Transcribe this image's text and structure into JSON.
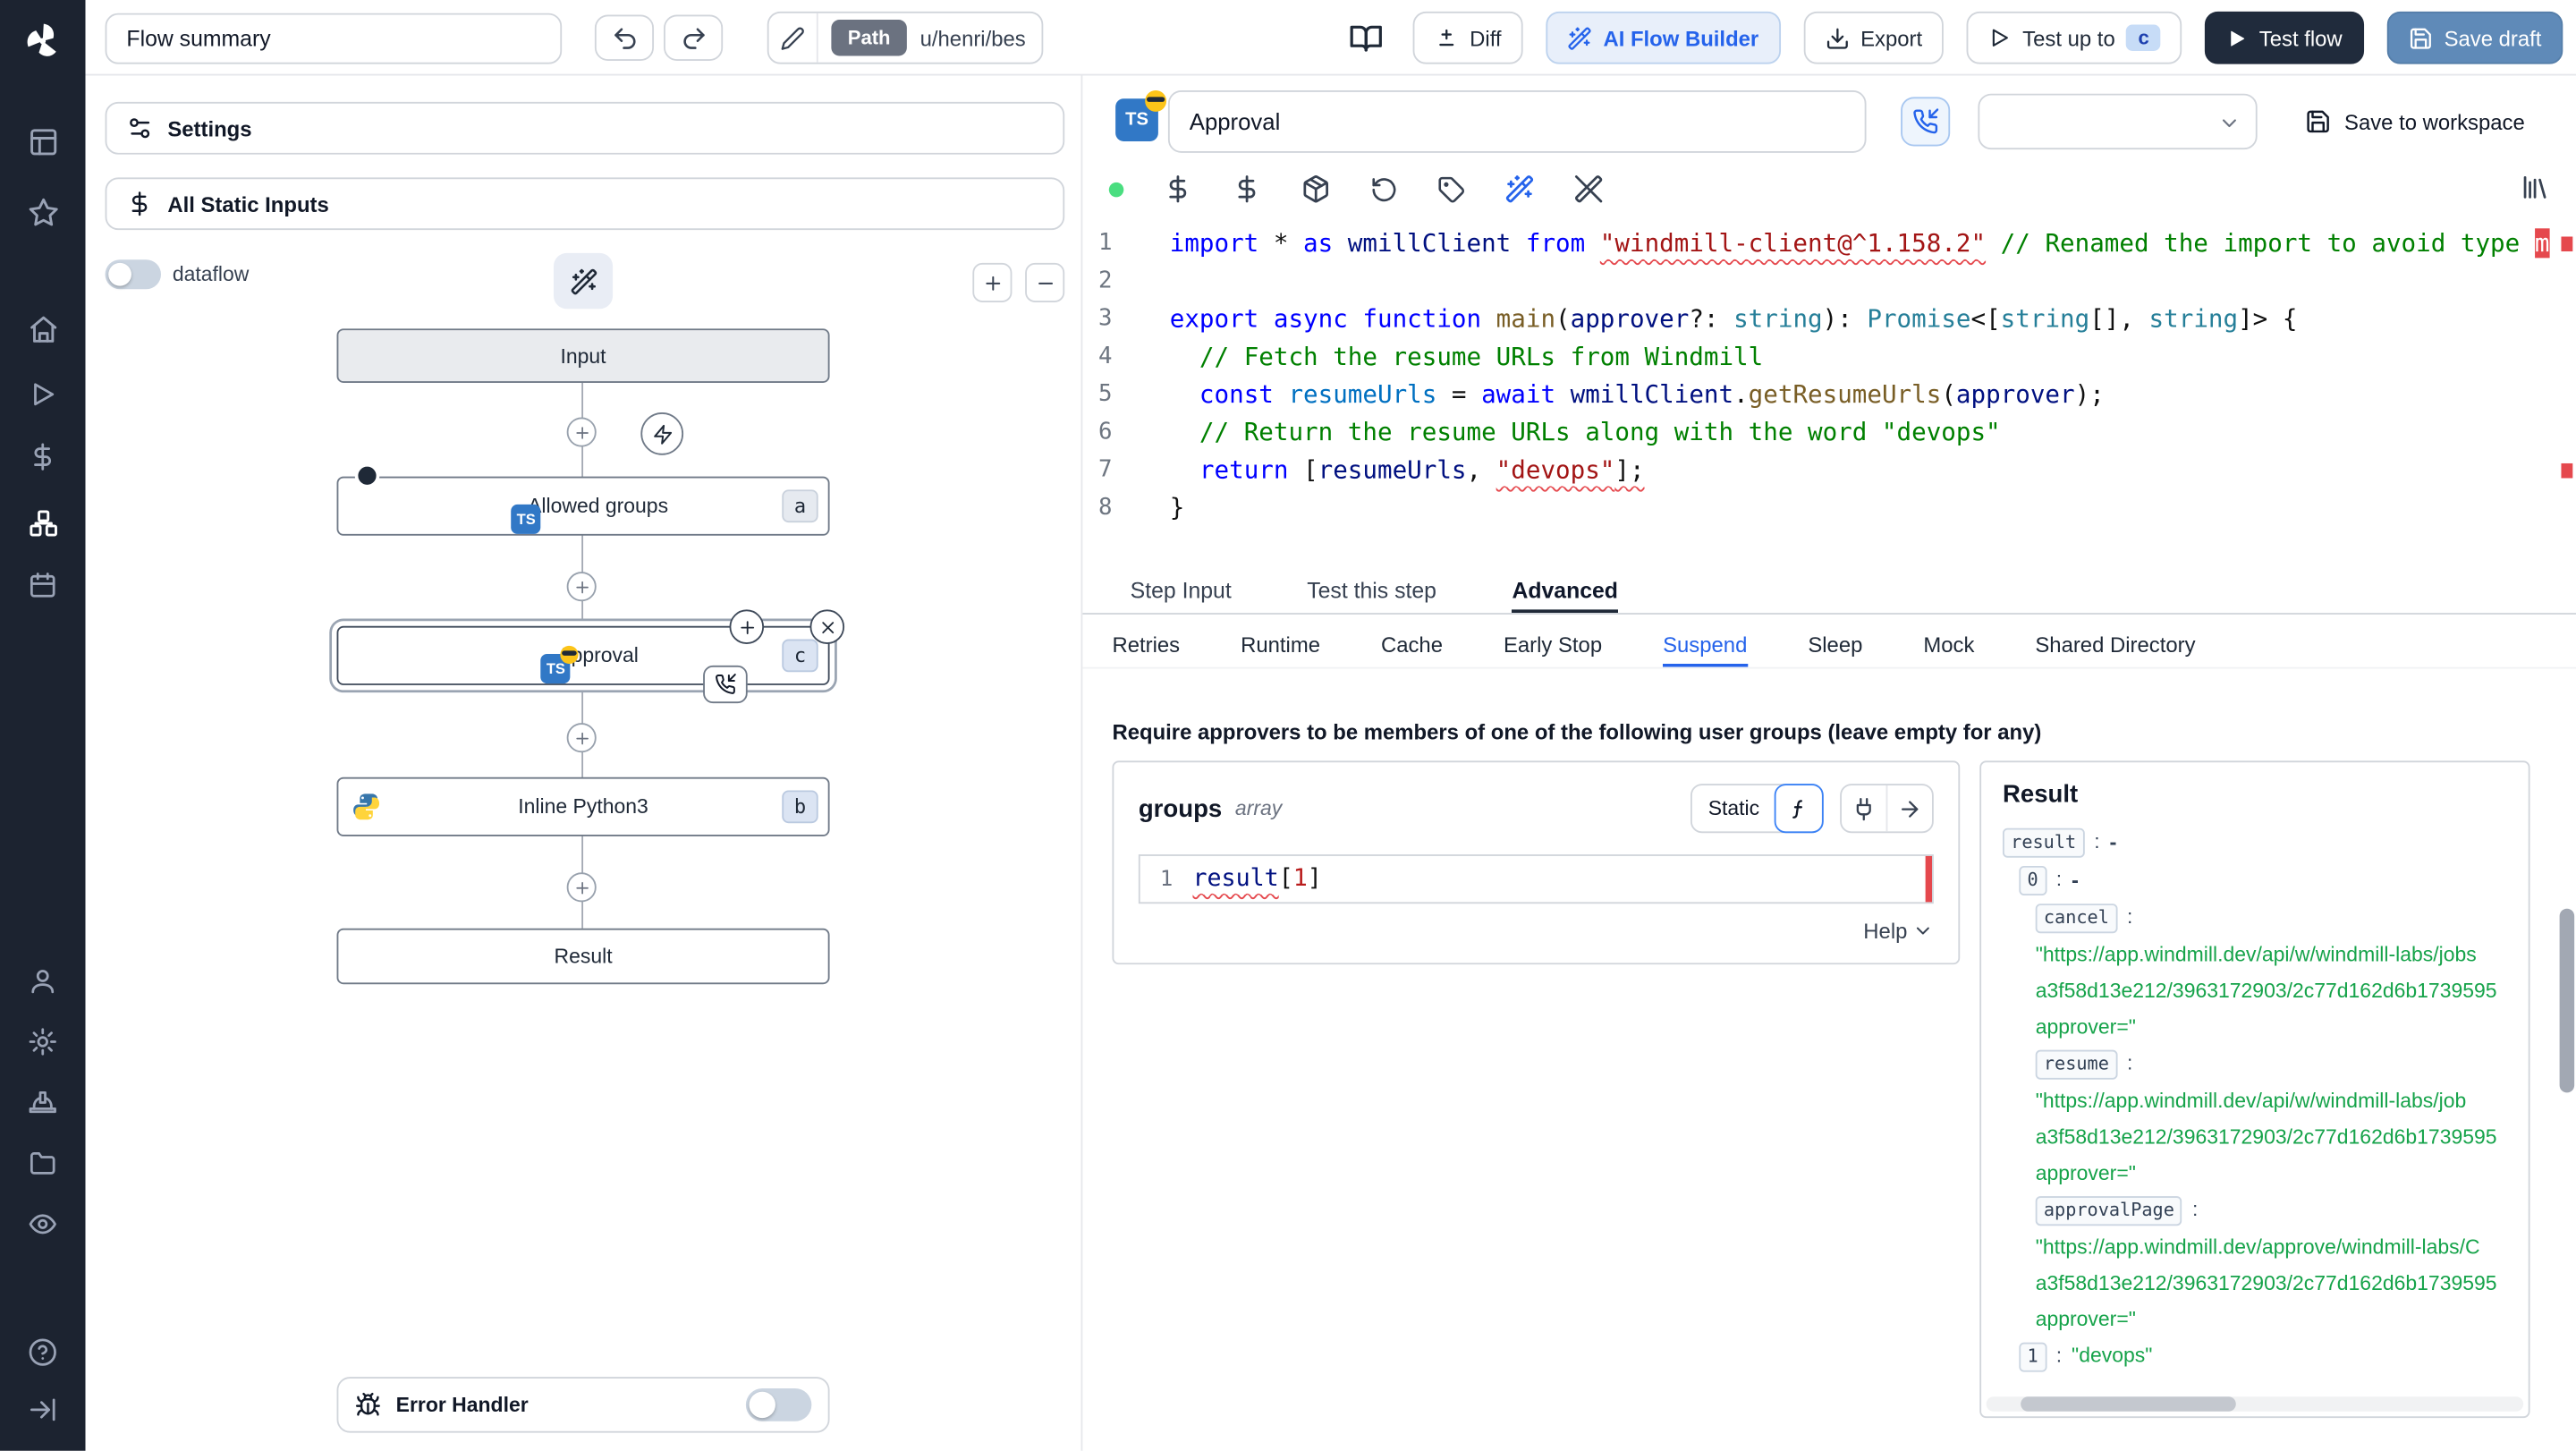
{
  "colors": {
    "sidebar_bg": "#1c2330",
    "accent_blue": "#2563eb",
    "ts_blue": "#3178c6",
    "save_draft_bg": "#5f8ab8",
    "test_flow_bg": "#202b3c",
    "result_green": "#16a34a",
    "error_red": "#e5484d",
    "status_green": "#4ade80"
  },
  "sidebar_icons": [
    "windmill-logo",
    "apps",
    "favorites",
    "home",
    "runs",
    "variables",
    "resources",
    "schedules",
    "account",
    "settings",
    "workers",
    "folders",
    "audit-logs",
    "help",
    "expand"
  ],
  "toolbar_icons": [
    "status-dot",
    "variables",
    "resources",
    "package",
    "reset",
    "tag",
    "ai-wand",
    "ai-wand-off",
    "library"
  ],
  "topbar": {
    "flow_summary_value": "Flow summary",
    "path_chip": "Path",
    "path_value": "u/henri/bes",
    "diff": "Diff",
    "ai_flow_builder": "AI Flow Builder",
    "export": "Export",
    "test_up_to": "Test up to",
    "test_up_to_badge": "c",
    "test_flow": "Test flow",
    "save_draft": "Save draft"
  },
  "flow_panel": {
    "settings": "Settings",
    "all_static_inputs": "All Static Inputs",
    "dataflow": "dataflow",
    "nodes": {
      "input": "Input",
      "allowed_groups": "Allowed groups",
      "allowed_groups_badge": "a",
      "approval": "Approval",
      "approval_badge": "c",
      "inline_python": "Inline Python3",
      "inline_python_badge": "b",
      "result": "Result"
    },
    "error_handler": "Error Handler"
  },
  "step_editor": {
    "name_value": "Approval",
    "ts_badge": "TS",
    "save_to_workspace": "Save to workspace"
  },
  "editor": {
    "lines": [
      {
        "no": "1",
        "tokens": [
          [
            "k",
            "import"
          ],
          [
            "d",
            " * "
          ],
          [
            "k",
            "as"
          ],
          [
            "d",
            " "
          ],
          [
            "v",
            "wmillClient"
          ],
          [
            "d",
            " "
          ],
          [
            "k",
            "from"
          ],
          [
            "d",
            " "
          ],
          [
            "s",
            "\"windmill-client@^1.158.2\"",
            "sq"
          ],
          [
            "d",
            " "
          ],
          [
            "c",
            "// Renamed the import to avoid type "
          ],
          [
            "e",
            "m"
          ]
        ]
      },
      {
        "no": "2",
        "tokens": []
      },
      {
        "no": "3",
        "tokens": [
          [
            "k",
            "export"
          ],
          [
            "d",
            " "
          ],
          [
            "k",
            "async"
          ],
          [
            "d",
            " "
          ],
          [
            "k",
            "function"
          ],
          [
            "d",
            " "
          ],
          [
            "f",
            "main"
          ],
          [
            "d",
            "("
          ],
          [
            "v",
            "approver"
          ],
          [
            "d",
            "?: "
          ],
          [
            "t",
            "string"
          ],
          [
            "d",
            "): "
          ],
          [
            "t",
            "Promise"
          ],
          [
            "d",
            "<["
          ],
          [
            "t",
            "string"
          ],
          [
            "d",
            "[], "
          ],
          [
            "t",
            "string"
          ],
          [
            "d",
            "]> {"
          ]
        ]
      },
      {
        "no": "4",
        "tokens": [
          [
            "d",
            "  "
          ],
          [
            "c",
            "// Fetch the resume URLs from Windmill"
          ]
        ]
      },
      {
        "no": "5",
        "tokens": [
          [
            "d",
            "  "
          ],
          [
            "k",
            "const"
          ],
          [
            "d",
            " "
          ],
          [
            "v2",
            "resumeUrls"
          ],
          [
            "d",
            " = "
          ],
          [
            "k",
            "await"
          ],
          [
            "d",
            " "
          ],
          [
            "v",
            "wmillClient"
          ],
          [
            "d",
            "."
          ],
          [
            "f",
            "getResumeUrls"
          ],
          [
            "d",
            "("
          ],
          [
            "v",
            "approver"
          ],
          [
            "d",
            ");"
          ]
        ]
      },
      {
        "no": "6",
        "tokens": [
          [
            "d",
            "  "
          ],
          [
            "c",
            "// Return the resume URLs along with the word \"devops\""
          ]
        ]
      },
      {
        "no": "7",
        "tokens": [
          [
            "d",
            "  "
          ],
          [
            "k",
            "return"
          ],
          [
            "d",
            " ["
          ],
          [
            "v",
            "resumeUrls"
          ],
          [
            "d",
            ", "
          ],
          [
            "s",
            "\"devops\"",
            "sq"
          ],
          [
            "d",
            "];",
            "sq"
          ]
        ]
      },
      {
        "no": "8",
        "tokens": [
          [
            "d",
            "}"
          ]
        ]
      }
    ]
  },
  "tabs": {
    "primary": [
      "Step Input",
      "Test this step",
      "Advanced"
    ],
    "primary_active": "Advanced",
    "secondary": [
      "Retries",
      "Runtime",
      "Cache",
      "Early Stop",
      "Suspend",
      "Sleep",
      "Mock",
      "Shared Directory"
    ],
    "secondary_active": "Suspend"
  },
  "suspend": {
    "description": "Require approvers to be members of one of the following user groups (leave empty for any)",
    "groups_label": "groups",
    "groups_type": "array",
    "static_label": "Static",
    "line_no": "1",
    "help": "Help"
  },
  "groups_editor": {
    "tokens": [
      [
        "v",
        "result",
        "sq"
      ],
      [
        "d",
        "["
      ],
      [
        "r",
        "1"
      ],
      [
        "d",
        "]"
      ]
    ]
  },
  "result_panel": {
    "title": "Result",
    "entries": [
      {
        "indent": 0,
        "key": "result",
        "value": "-",
        "kind": "plain"
      },
      {
        "indent": 1,
        "key": "0",
        "value": "-",
        "kind": "plain"
      },
      {
        "indent": 2,
        "key": "cancel",
        "lines": [
          "\"https://app.windmill.dev/api/w/windmill-labs/jobs",
          "a3f58d13e212/3963172903/2c77d162d6b1739595",
          "approver=\""
        ]
      },
      {
        "indent": 2,
        "key": "resume",
        "lines": [
          "\"https://app.windmill.dev/api/w/windmill-labs/job",
          "a3f58d13e212/3963172903/2c77d162d6b1739595",
          "approver=\""
        ]
      },
      {
        "indent": 2,
        "key": "approvalPage",
        "lines": [
          "\"https://app.windmill.dev/approve/windmill-labs/C",
          "a3f58d13e212/3963172903/2c77d162d6b1739595",
          "approver=\""
        ]
      },
      {
        "indent": 1,
        "key": "1",
        "value": "\"devops\"",
        "kind": "string"
      }
    ]
  }
}
